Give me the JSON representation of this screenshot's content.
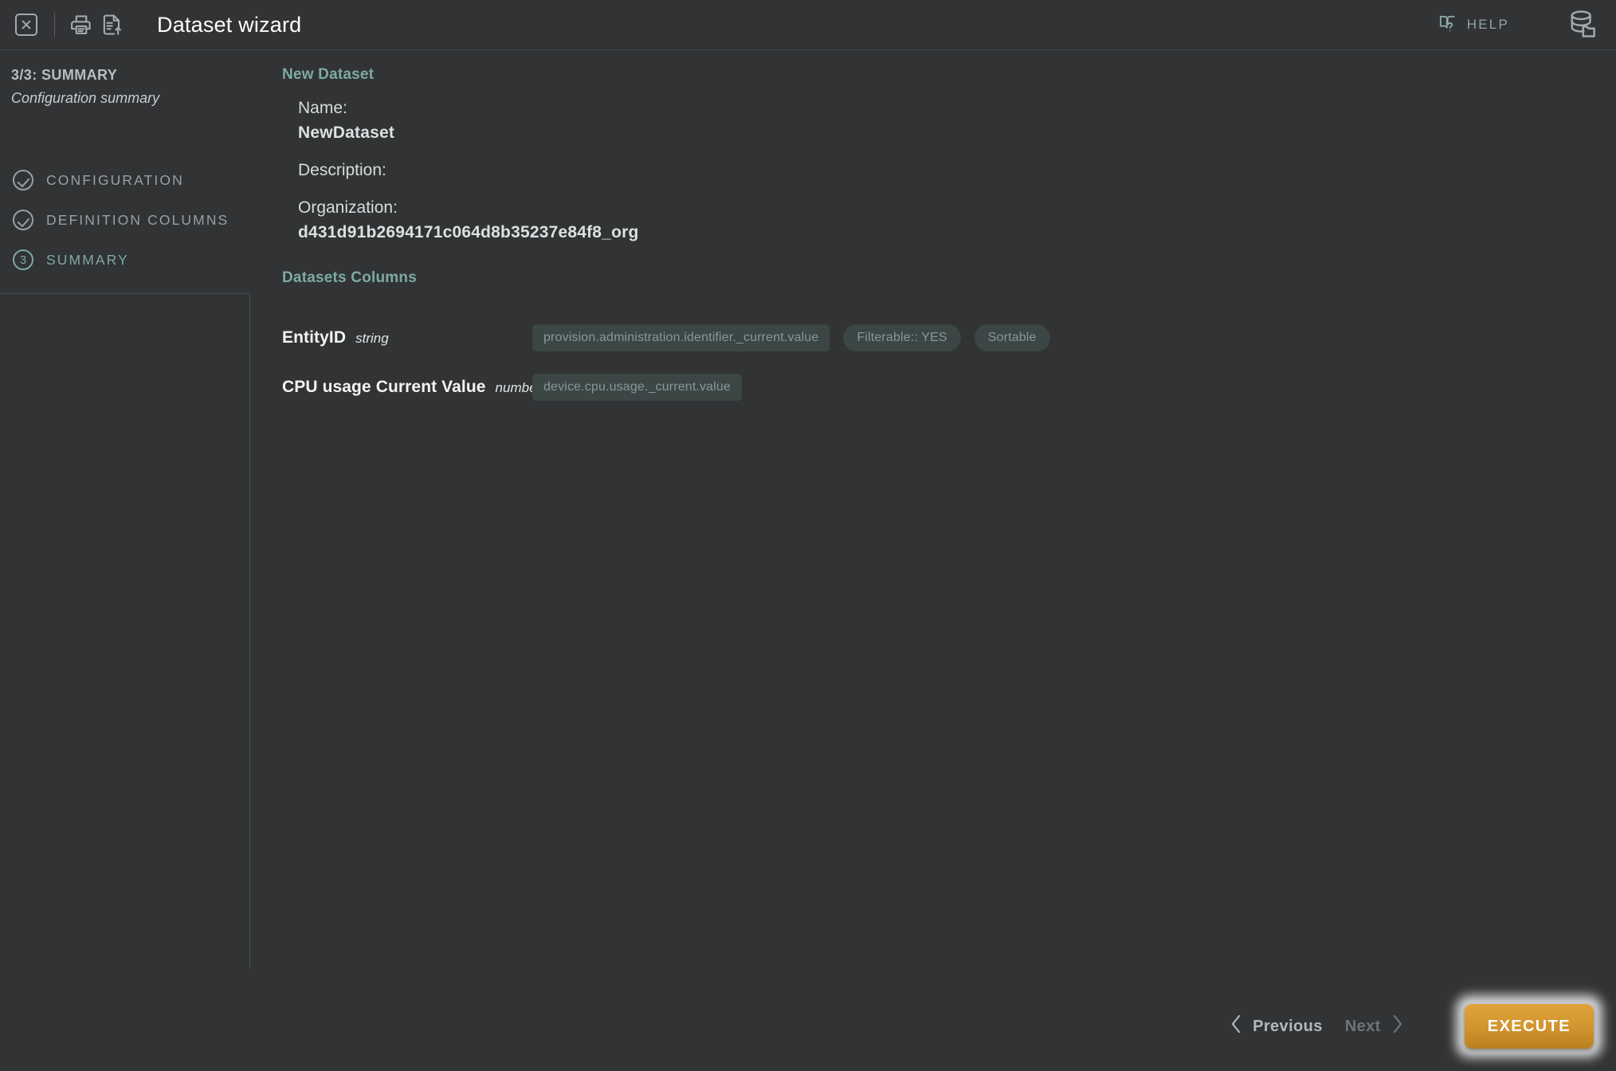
{
  "window": {
    "title": "Dataset wizard",
    "background_color": "#313335"
  },
  "header": {
    "close_icon": "close-icon",
    "print_icon": "printer-icon",
    "export_icon": "document-export-icon",
    "title": "Dataset wizard",
    "help_label": "HELP",
    "help_icon": "book-question-icon",
    "database_icon": "database-stack-icon",
    "accent_color": "#8fa7a8"
  },
  "sidebar": {
    "step_indicator": "3/3: SUMMARY",
    "subtitle": "Configuration summary",
    "steps": [
      {
        "label": "CONFIGURATION",
        "state": "done",
        "marker": "check-icon"
      },
      {
        "label": "DEFINITION COLUMNS",
        "state": "done",
        "marker": "check-icon"
      },
      {
        "label": "SUMMARY",
        "state": "current",
        "marker": "3"
      }
    ]
  },
  "main": {
    "new_dataset": {
      "section_title": "New Dataset",
      "fields": [
        {
          "label": "Name:",
          "value": "NewDataset"
        },
        {
          "label": "Description:",
          "value": ""
        },
        {
          "label": "Organization:",
          "value": "d431d91b2694171c064d8b35237e84f8_org"
        }
      ]
    },
    "datasets_columns": {
      "section_title": "Datasets Columns",
      "columns": [
        {
          "name": "EntityID",
          "type": "string",
          "chips": [
            {
              "text": "provision.administration.identifier._current.value",
              "style": "path"
            },
            {
              "text": "Filterable:: YES",
              "style": "flag"
            },
            {
              "text": "Sortable",
              "style": "flag"
            }
          ]
        },
        {
          "name": "CPU usage Current Value",
          "type": "number",
          "chips": [
            {
              "text": "device.cpu.usage._current.value",
              "style": "path"
            }
          ]
        }
      ]
    }
  },
  "footer": {
    "previous_label": "Previous",
    "previous_icon": "chevron-left-icon",
    "next_label": "Next",
    "next_icon": "chevron-right-icon",
    "next_disabled": true,
    "execute_label": "EXECUTE",
    "execute_color": "#d4962f",
    "execute_focused": true
  }
}
